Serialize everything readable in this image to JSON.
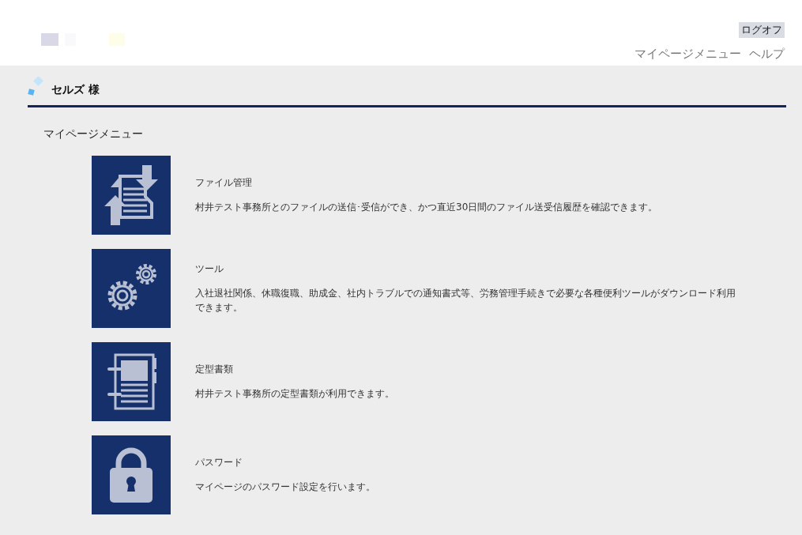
{
  "header": {
    "logoff": "ログオフ",
    "links": [
      "マイページメニュー",
      "ヘルプ"
    ]
  },
  "user": {
    "name": "セルズ 様"
  },
  "section_title": "マイページメニュー",
  "menu": [
    {
      "kind": "file",
      "title": "ファイル管理",
      "description": "村井テスト事務所とのファイルの送信･受信ができ、かつ直近30日間のファイル送受信履歴を確認できます。"
    },
    {
      "kind": "tools",
      "title": "ツール",
      "description": "入社退社関係、休職復職、助成金、社内トラブルでの通知書式等、労務管理手続きで必要な各種便利ツールがダウンロード利用できます。"
    },
    {
      "kind": "documents",
      "title": "定型書類",
      "description": "村井テスト事務所の定型書類が利用できます。"
    },
    {
      "kind": "password",
      "title": "パスワード",
      "description": "マイページのパスワード設定を行います。"
    }
  ]
}
